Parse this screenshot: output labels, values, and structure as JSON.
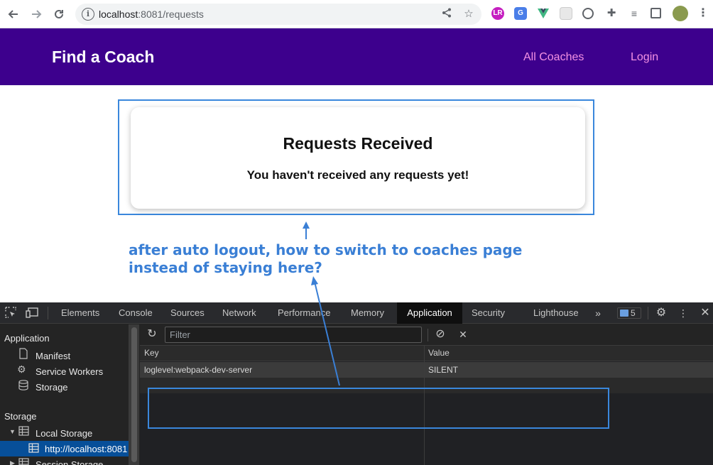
{
  "browser": {
    "url_host": "localhost",
    "url_rest": ":8081/requests",
    "icons": [
      "back-arrow-icon",
      "forward-arrow-icon",
      "reload-icon",
      "info-icon",
      "share-icon",
      "star-icon"
    ],
    "extensions": [
      "lr-extension-icon",
      "translate-icon",
      "vue-devtools-icon",
      "extension-icon",
      "extension-icon",
      "puzzle-icon",
      "reading-list-icon",
      "side-panel-icon",
      "profile-avatar"
    ]
  },
  "site": {
    "title": "Find a Coach",
    "nav": [
      "All Coaches",
      "Login"
    ]
  },
  "card": {
    "title": "Requests Received",
    "message": "You haven't received any requests yet!"
  },
  "annotation": {
    "line1": "after auto logout, how to switch to coaches page",
    "line2": "instead of staying here?"
  },
  "devtools": {
    "tabs": [
      "Elements",
      "Console",
      "Sources",
      "Network",
      "Performance",
      "Memory",
      "Application",
      "Security",
      "Lighthouse"
    ],
    "active_tab": "Application",
    "issues_count": "5",
    "sidebar": {
      "section1": "Application",
      "items1": [
        "Manifest",
        "Service Workers",
        "Storage"
      ],
      "section2": "Storage",
      "local_storage": "Local Storage",
      "local_origin": "http://localhost:8081",
      "session_storage": "Session Storage"
    },
    "filter_placeholder": "Filter",
    "columns": [
      "Key",
      "Value"
    ],
    "rows": [
      {
        "key": "loglevel:webpack-dev-server",
        "value": "SILENT"
      }
    ]
  },
  "colors": {
    "header_bg": "#3d008d",
    "nav_link": "#f391e3",
    "annotation_blue": "#3a7fd5",
    "devtools_selected": "#074f99"
  }
}
